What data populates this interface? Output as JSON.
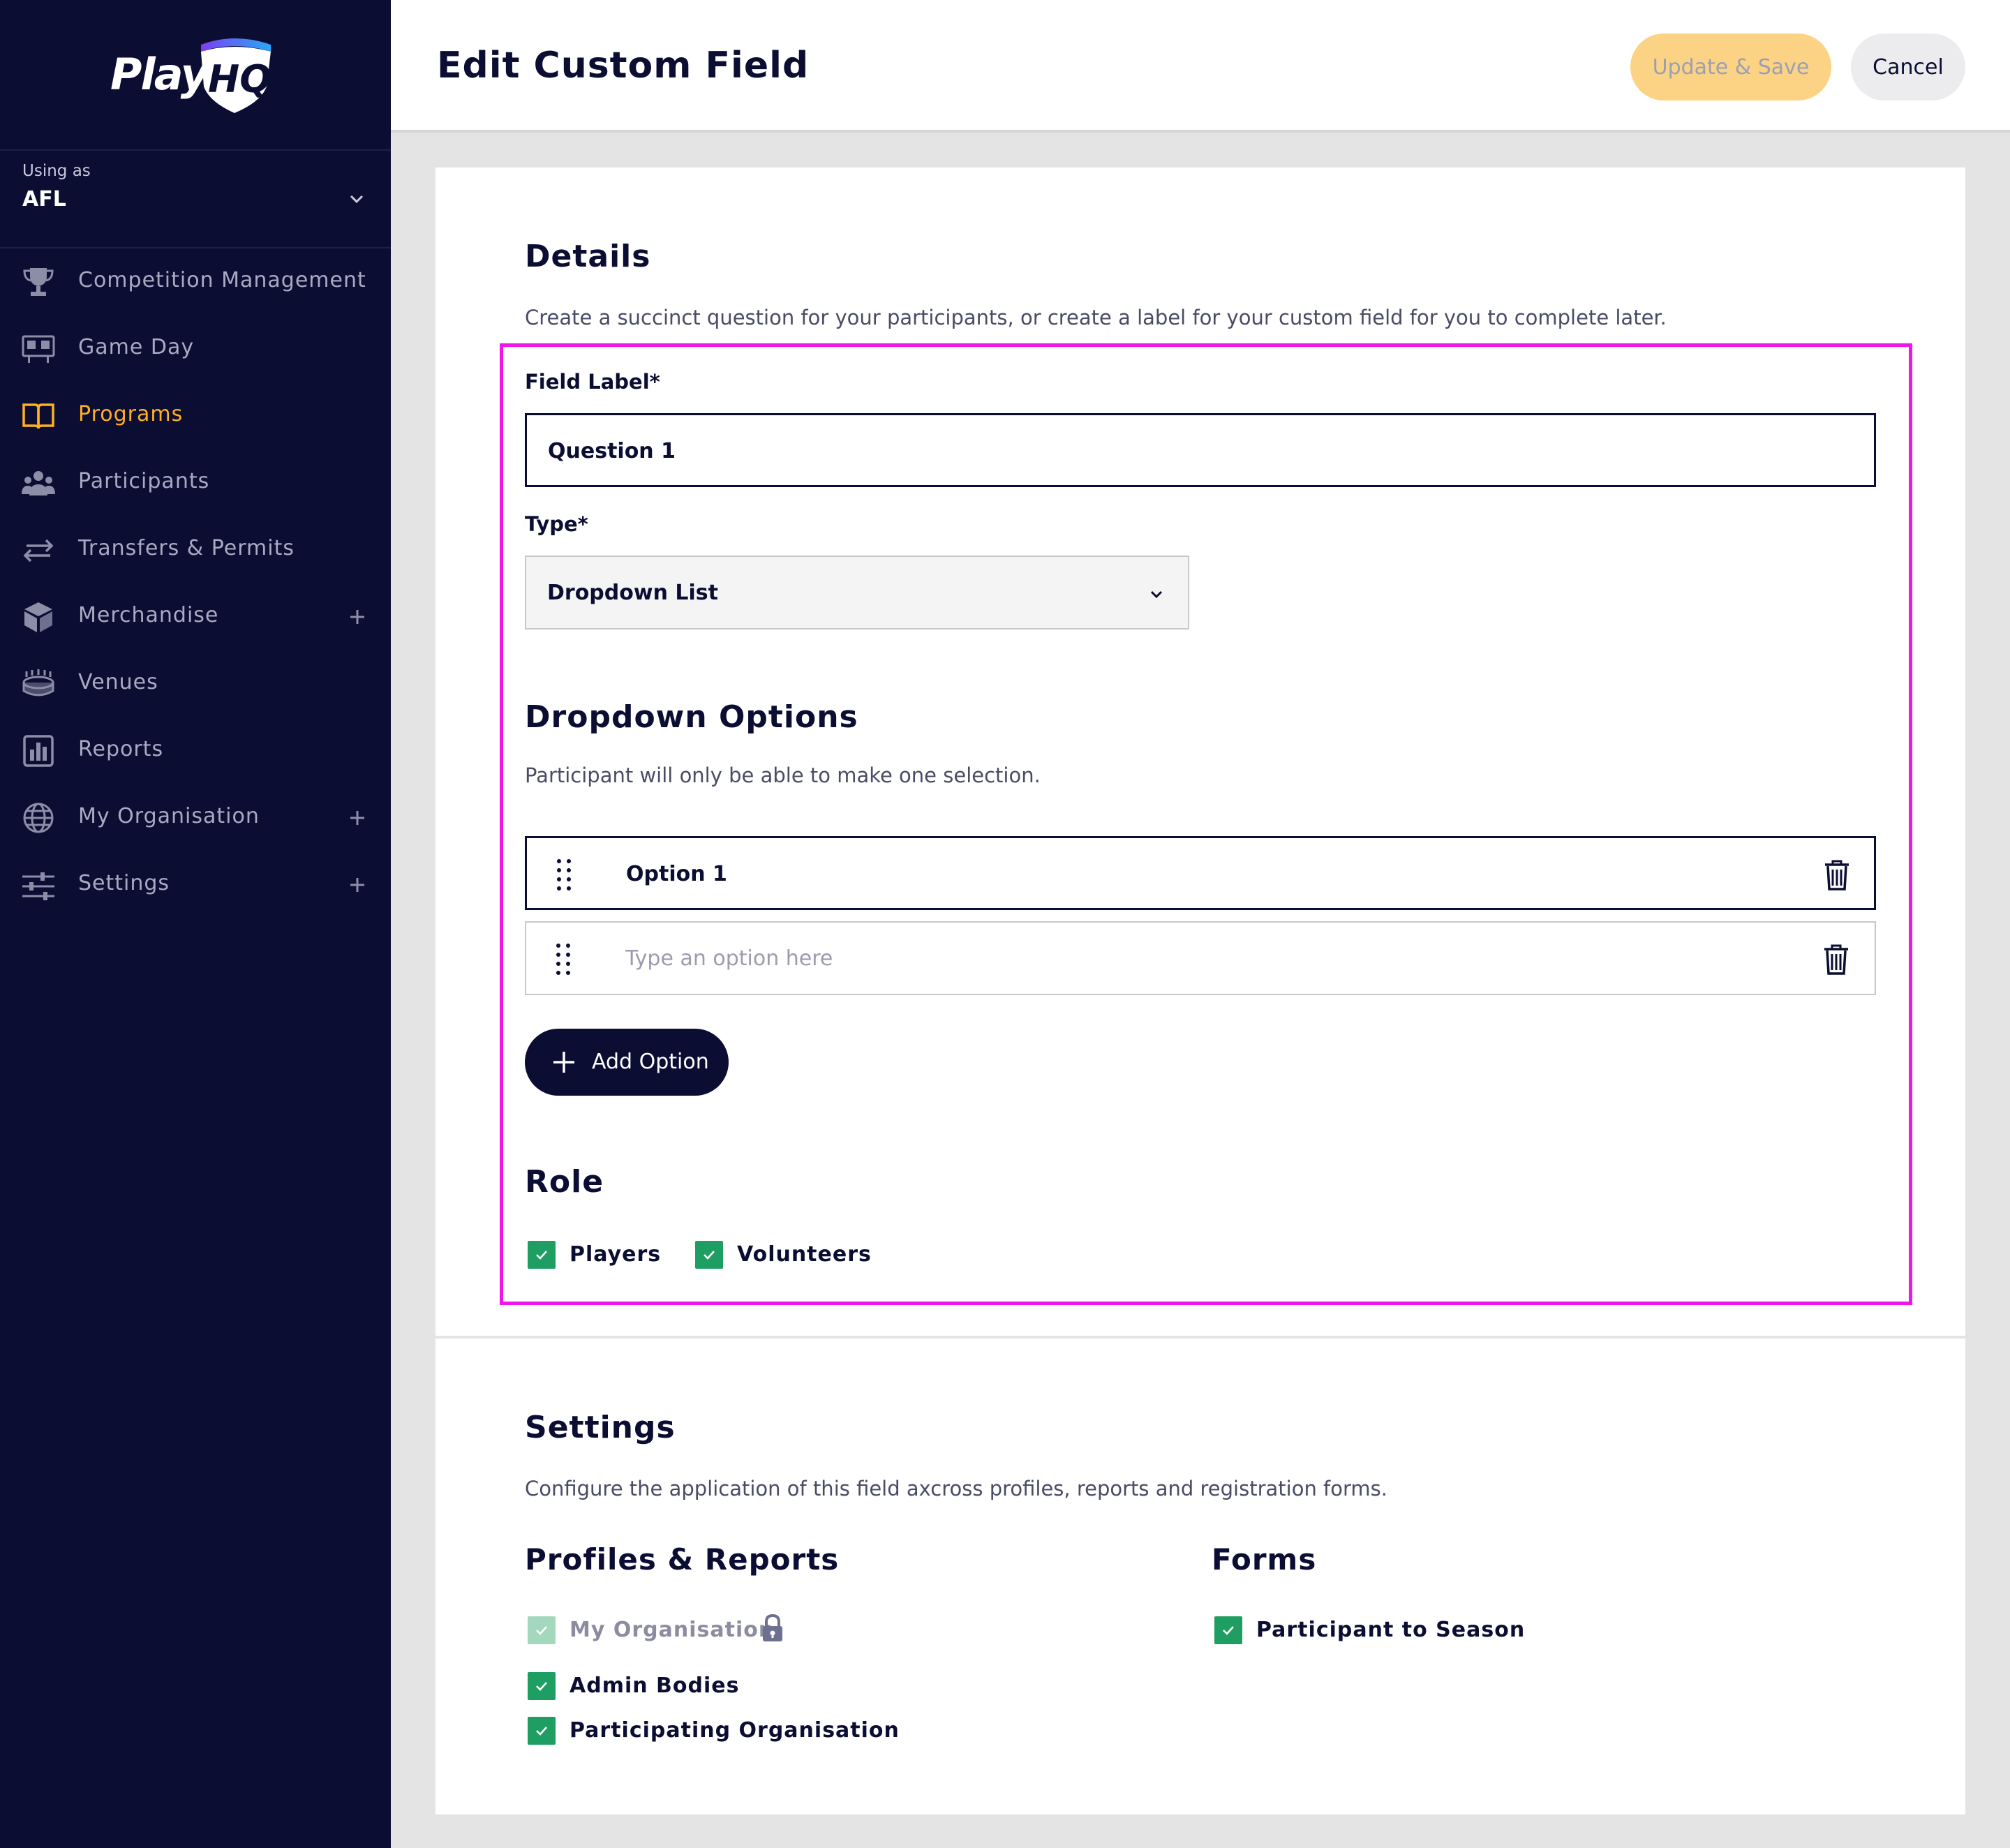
{
  "brand": {
    "logo_text": "Play",
    "logo_badge": "HQ",
    "accent": "#ffb020",
    "nav_bg": "#0b0d33",
    "success": "#1e9e62",
    "highlight": "#f015ed"
  },
  "sidebar": {
    "using_label": "Using as",
    "using_value": "AFL",
    "items": [
      {
        "label": "Competition Management",
        "icon": "trophy-icon",
        "expandable": false,
        "active": false
      },
      {
        "label": "Game Day",
        "icon": "scoreboard-icon",
        "expandable": false,
        "active": false
      },
      {
        "label": "Programs",
        "icon": "book-icon",
        "expandable": false,
        "active": true
      },
      {
        "label": "Participants",
        "icon": "people-icon",
        "expandable": false,
        "active": false
      },
      {
        "label": "Transfers & Permits",
        "icon": "transfer-arrows-icon",
        "expandable": false,
        "active": false
      },
      {
        "label": "Merchandise",
        "icon": "box-icon",
        "expandable": true,
        "active": false
      },
      {
        "label": "Venues",
        "icon": "stadium-icon",
        "expandable": false,
        "active": false
      },
      {
        "label": "Reports",
        "icon": "chart-icon",
        "expandable": false,
        "active": false
      },
      {
        "label": "My Organisation",
        "icon": "globe-icon",
        "expandable": true,
        "active": false
      },
      {
        "label": "Settings",
        "icon": "sliders-icon",
        "expandable": true,
        "active": false
      }
    ]
  },
  "header": {
    "title": "Edit Custom Field",
    "save_label": "Update & Save",
    "cancel_label": "Cancel"
  },
  "details": {
    "heading": "Details",
    "description": "Create a succinct question for your participants, or create a label for your custom field for you to complete later.",
    "field_label_label": "Field Label*",
    "field_label_value": "Question 1",
    "type_label": "Type*",
    "type_value": "Dropdown List"
  },
  "dropdown_options": {
    "heading": "Dropdown Options",
    "description": "Participant will only be able to make one selection.",
    "options": [
      "Option 1"
    ],
    "new_option_placeholder": "Type an option here",
    "add_label": "Add Option"
  },
  "role": {
    "heading": "Role",
    "players_label": "Players",
    "players_checked": true,
    "volunteers_label": "Volunteers",
    "volunteers_checked": true
  },
  "settings": {
    "heading": "Settings",
    "description": "Configure the application of this field axcross profiles, reports and registration forms.",
    "profiles_heading": "Profiles & Reports",
    "forms_heading": "Forms",
    "my_org_label": "My Organisation",
    "my_org_locked": true,
    "admin_bodies_label": "Admin Bodies",
    "participating_org_label": "Participating Organisation",
    "participant_to_season_label": "Participant to Season"
  }
}
